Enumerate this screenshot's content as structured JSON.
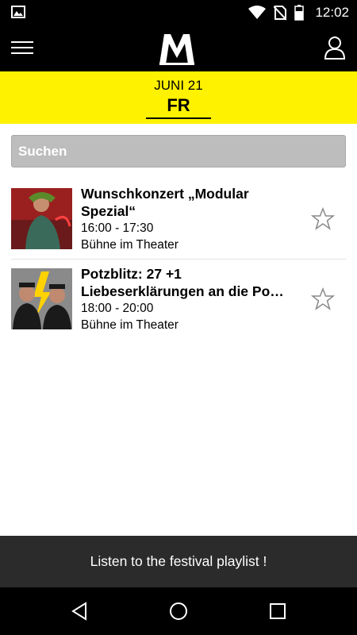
{
  "status_bar": {
    "time": "12:02",
    "icons": [
      "image-notification-icon",
      "wifi-icon",
      "no-sim-icon",
      "battery-icon"
    ]
  },
  "app_bar": {
    "logo": "M",
    "icons": [
      "menu-icon",
      "profile-icon"
    ]
  },
  "date_banner": {
    "month": "JUNI 21",
    "day": "FR",
    "background": "#fff200"
  },
  "search": {
    "placeholder": "Suchen"
  },
  "events": [
    {
      "title": "Wunschkonzert „Modular\nSpezial“",
      "time": "16:00 - 17:30",
      "location": "Bühne im Theater",
      "favorite": false
    },
    {
      "title_line1": "Potzblitz: 27 +1",
      "title_line2": "Liebeserklärungen an die Pop…",
      "time": "18:00 - 20:00",
      "location": "Bühne im Theater",
      "favorite": false
    }
  ],
  "playlist_bar": {
    "label": "Listen to the festival playlist !"
  },
  "nav_bar": {
    "icons": [
      "back-icon",
      "home-icon",
      "recents-icon"
    ]
  }
}
